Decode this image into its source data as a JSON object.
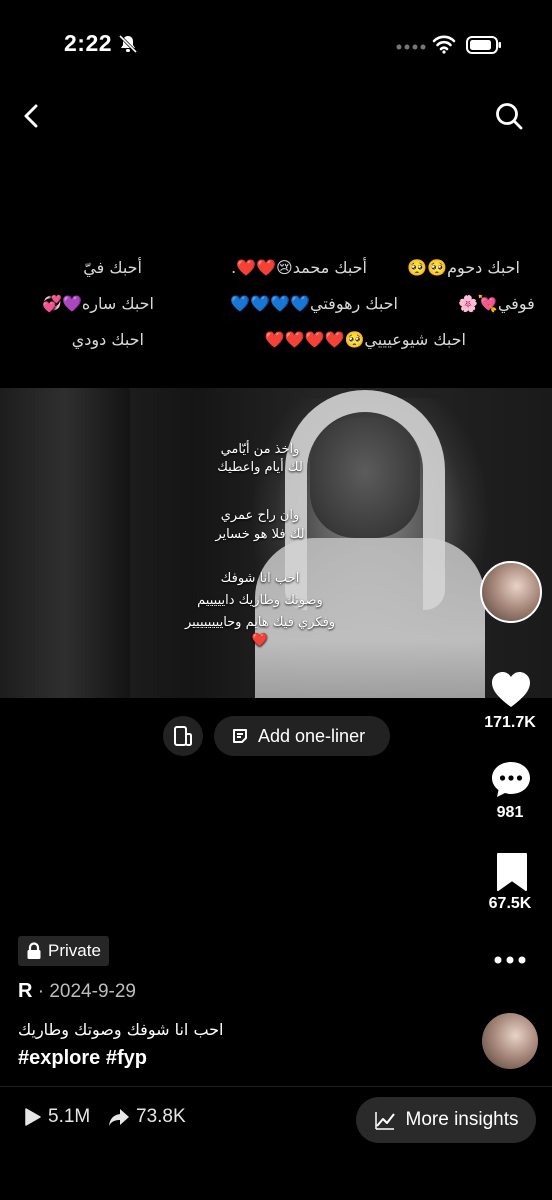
{
  "status_bar": {
    "time": "2:22"
  },
  "header_overlay_lines": [
    {
      "text": "احبك دحوم🥺🥺",
      "slot": "r1c1"
    },
    {
      "text": "أحبك محمد😢❤️❤️.",
      "slot": "r1c2"
    },
    {
      "text": "أحبك فيّ",
      "slot": "r1c3"
    },
    {
      "text": "احبك رهوفتي💙💙💙💙",
      "slot": "r2c1"
    },
    {
      "text": "احبك ساره💜💞",
      "slot": "r2c2"
    },
    {
      "text": "🌸💘فوفي",
      "slot": "r2c3"
    },
    {
      "text": "احبك شيوعيييي🥺❤️❤️❤️❤️",
      "slot": "r3c1"
    },
    {
      "text": "احبك دودي",
      "slot": "r3c2"
    }
  ],
  "video_text": {
    "l1": "واخذ من أيّامي",
    "l2": "لك أيام واعطيك",
    "l3": "وان راح عمري",
    "l4": "لك فلا هو خساير",
    "l5": "احب انا شوفك",
    "l6": "وصوتك وطاريك دايييييم",
    "l7": "وفكري فيك هايم وحايييييييير",
    "l8": "❤️"
  },
  "actions": {
    "one_liner_label": "Add one-liner",
    "likes": "171.7K",
    "comments": "981",
    "saves": "67.5K"
  },
  "post": {
    "privacy": "Private",
    "author": "R",
    "date": "2024-9-29",
    "caption": "احب انا شوفك وصوتك وطاريك",
    "hashtags": "#explore #fyp"
  },
  "footer": {
    "plays": "5.1M",
    "shares": "73.8K",
    "insights_label": "More insights"
  }
}
